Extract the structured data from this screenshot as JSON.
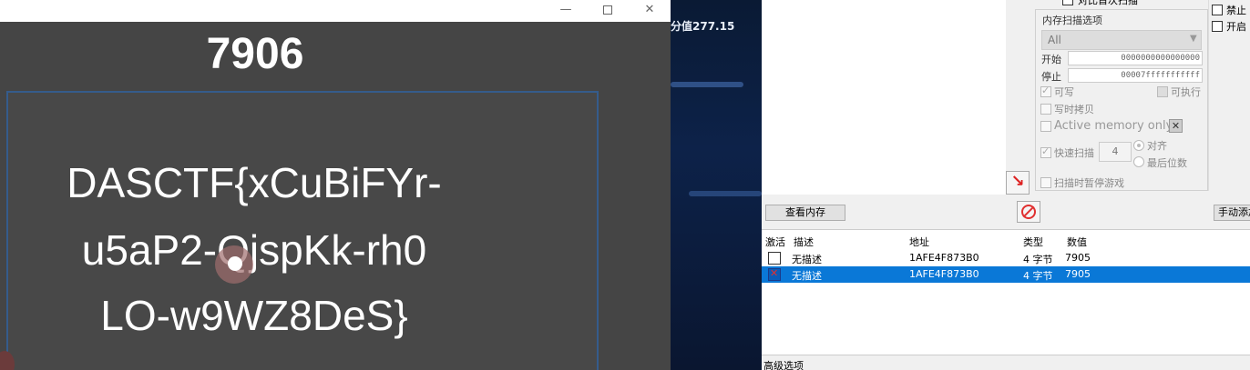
{
  "game": {
    "titlebar": {
      "minimize": "—",
      "maximize": "",
      "close": "✕"
    },
    "score": "7906",
    "flag_lines": [
      "DASCTF{xCuBiFYr-",
      "u5aP2-QjspKk-rh0",
      "LO-w9WZ8DeS}"
    ]
  },
  "middle": {
    "text": "分值277.15"
  },
  "ce": {
    "compare_first_scan": "对比首次扫描",
    "options_title": "内存扫描选项",
    "memory_region": "All",
    "start_label": "开始",
    "start_value": "0000000000000000",
    "stop_label": "停止",
    "stop_value": "00007fffffffffff",
    "writable": "可写",
    "executable": "可执行",
    "copy_on_write": "写时拷贝",
    "active_memory_only": "Active memory only",
    "active_x": "✕",
    "fast_scan": "快速扫描",
    "fast_scan_value": "4",
    "alignment": "对齐",
    "last_digits": "最后位数",
    "pause_game": "扫描时暂停游戏",
    "right_col": {
      "no_random": "禁止",
      "enable": "开启"
    },
    "arrow_icon": "↘",
    "view_memory": "查看内存",
    "manual_add": "手动添加",
    "table": {
      "headers": {
        "active": "激活",
        "desc": "描述",
        "address": "地址",
        "type": "类型",
        "value": "数值"
      },
      "rows": [
        {
          "desc": "无描述",
          "address": "1AFE4F873B0",
          "type": "4 字节",
          "value": "7905"
        },
        {
          "desc": "无描述",
          "address": "1AFE4F873B0",
          "type": "4 字节",
          "value": "7905"
        }
      ]
    },
    "advanced_options": "高级选项"
  }
}
